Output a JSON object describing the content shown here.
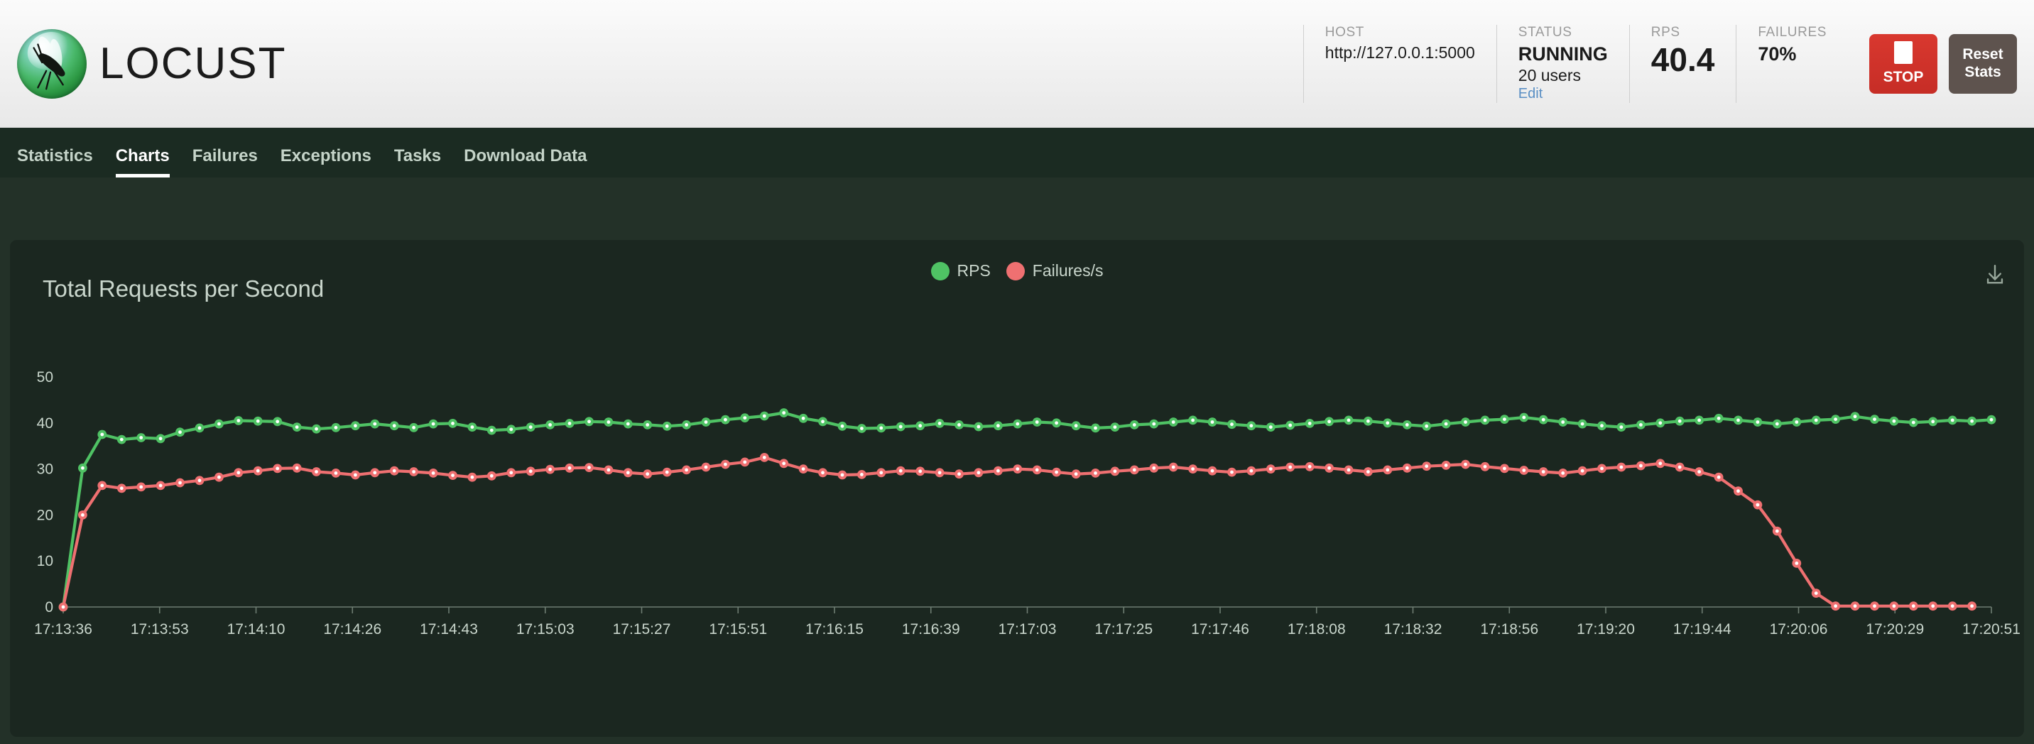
{
  "brand": {
    "name": "LOCUST",
    "logo_icon": "locust-logo-icon"
  },
  "header": {
    "stats": [
      {
        "label": "HOST",
        "value": "http://127.0.0.1:5000"
      },
      {
        "label": "STATUS",
        "value": "RUNNING",
        "sub": "20 users",
        "edit_label": "Edit"
      },
      {
        "label": "RPS",
        "value": "40.4"
      },
      {
        "label": "FAILURES",
        "value": "70%"
      }
    ],
    "stop_button": {
      "label": "STOP",
      "icon": "stop-square-icon",
      "color": "#cf2f27"
    },
    "reset_button": {
      "label": "Reset Stats",
      "line1": "Reset",
      "line2": "Stats",
      "color": "#5e534e"
    }
  },
  "nav": {
    "items": [
      {
        "label": "Statistics",
        "active": false
      },
      {
        "label": "Charts",
        "active": true
      },
      {
        "label": "Failures",
        "active": false
      },
      {
        "label": "Exceptions",
        "active": false
      },
      {
        "label": "Tasks",
        "active": false
      },
      {
        "label": "Download Data",
        "active": false
      }
    ]
  },
  "chart_card": {
    "download_icon": "download-icon"
  },
  "chart_data": {
    "type": "line",
    "title": "Total Requests per Second",
    "xlabel": "",
    "ylabel": "",
    "ylim": [
      0,
      52
    ],
    "yticks": [
      0,
      10,
      20,
      30,
      40,
      50
    ],
    "grid": false,
    "legend_position": "top-center",
    "colors": {
      "RPS": "#4fc264",
      "Failures/s": "#ef7071"
    },
    "xtick_labels": [
      "17:13:36",
      "17:13:53",
      "17:14:10",
      "17:14:26",
      "17:14:43",
      "17:15:03",
      "17:15:27",
      "17:15:51",
      "17:16:15",
      "17:16:39",
      "17:17:03",
      "17:17:25",
      "17:17:46",
      "17:18:08",
      "17:18:32",
      "17:18:56",
      "17:19:20",
      "17:19:44",
      "17:20:06",
      "17:20:29",
      "17:20:51"
    ],
    "series": [
      {
        "name": "RPS",
        "color": "#4fc264",
        "values": [
          0,
          30.2,
          37.5,
          36.4,
          36.8,
          36.6,
          38,
          38.9,
          39.8,
          40.5,
          40.4,
          40.3,
          39.1,
          38.7,
          39,
          39.4,
          39.8,
          39.4,
          39,
          39.8,
          39.9,
          39.1,
          38.4,
          38.6,
          39.1,
          39.6,
          39.9,
          40.3,
          40.2,
          39.8,
          39.6,
          39.3,
          39.6,
          40.2,
          40.7,
          41.1,
          41.5,
          42.2,
          41,
          40.3,
          39.3,
          38.8,
          38.9,
          39.2,
          39.4,
          39.9,
          39.6,
          39.2,
          39.4,
          39.8,
          40.2,
          40,
          39.4,
          38.9,
          39.1,
          39.6,
          39.8,
          40.2,
          40.6,
          40.2,
          39.7,
          39.4,
          39.1,
          39.5,
          39.9,
          40.3,
          40.6,
          40.4,
          40,
          39.6,
          39.3,
          39.8,
          40.2,
          40.6,
          40.8,
          41.2,
          40.7,
          40.2,
          39.8,
          39.4,
          39.1,
          39.6,
          40,
          40.4,
          40.6,
          41,
          40.6,
          40.2,
          39.8,
          40.2,
          40.6,
          40.8,
          41.4,
          40.8,
          40.4,
          40.1,
          40.3,
          40.6,
          40.4,
          40.7
        ]
      },
      {
        "name": "Failures/s",
        "color": "#ef7071",
        "values": [
          0,
          20,
          26.4,
          25.8,
          26.1,
          26.4,
          27,
          27.5,
          28.2,
          29.2,
          29.6,
          30.1,
          30.2,
          29.4,
          29.1,
          28.7,
          29.2,
          29.6,
          29.4,
          29.1,
          28.6,
          28.2,
          28.5,
          29.2,
          29.5,
          29.9,
          30.2,
          30.3,
          29.8,
          29.2,
          28.9,
          29.3,
          29.8,
          30.4,
          31,
          31.5,
          32.5,
          31.2,
          30,
          29.2,
          28.7,
          28.8,
          29.2,
          29.6,
          29.5,
          29.2,
          28.9,
          29.2,
          29.6,
          30,
          29.8,
          29.3,
          28.9,
          29.1,
          29.5,
          29.8,
          30.2,
          30.4,
          30,
          29.6,
          29.3,
          29.6,
          30,
          30.4,
          30.5,
          30.2,
          29.8,
          29.4,
          29.8,
          30.2,
          30.6,
          30.8,
          31,
          30.5,
          30.1,
          29.7,
          29.4,
          29.1,
          29.6,
          30.1,
          30.4,
          30.7,
          31.2,
          30.4,
          29.4,
          28.2,
          25.2,
          22.2,
          16.5,
          9.5,
          3,
          0.2,
          0.2,
          0.2,
          0.2,
          0.2,
          0.2,
          0.2,
          0.2
        ]
      }
    ]
  }
}
